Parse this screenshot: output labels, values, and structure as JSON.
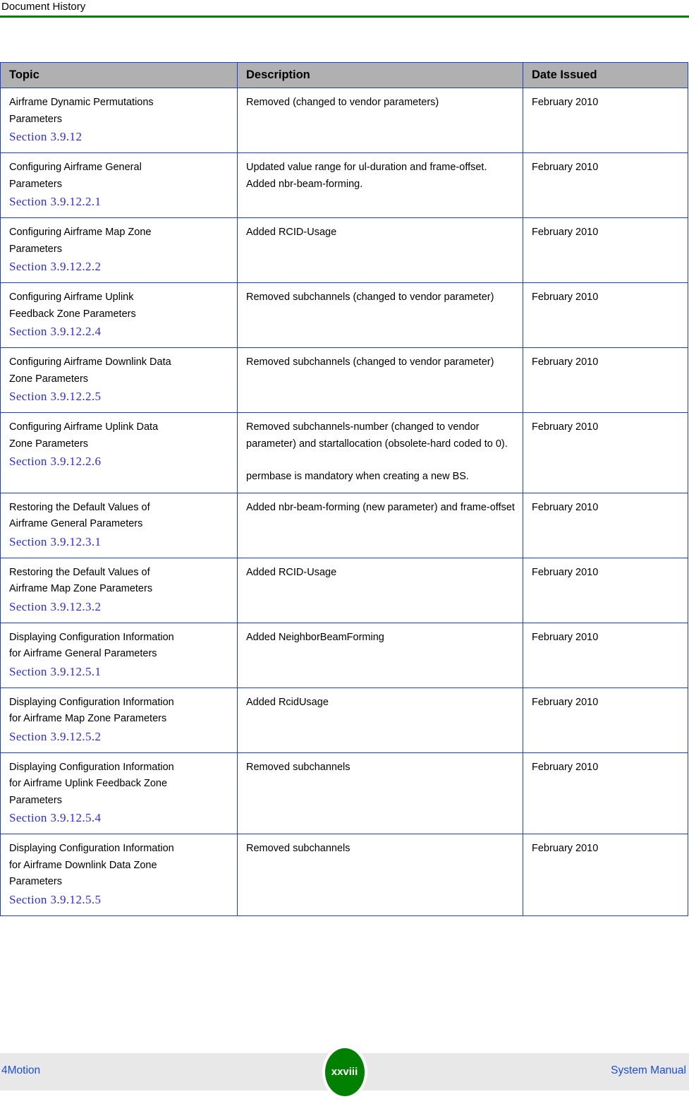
{
  "header": {
    "title": "Document History",
    "rule_color": "#008000"
  },
  "table": {
    "border_color": "#1a3ed0",
    "header_bg": "#b0b0b0",
    "link_color": "#2a2aee",
    "columns": [
      "Topic",
      "Description",
      "Date Issued"
    ],
    "rows": [
      {
        "topic_lines": [
          "Airframe Dynamic Permutations",
          "Parameters"
        ],
        "section": "Section 3.9.12",
        "description": [
          "Removed (changed to vendor parameters)"
        ],
        "date": "February 2010"
      },
      {
        "topic_lines": [
          "Configuring Airframe General",
          "Parameters"
        ],
        "section": "Section 3.9.12.2.1",
        "description": [
          "Updated value range for ul-duration and frame-offset. Added nbr-beam-forming."
        ],
        "date": "February 2010"
      },
      {
        "topic_lines": [
          "Configuring Airframe Map Zone",
          "Parameters"
        ],
        "section": "Section 3.9.12.2.2",
        "description": [
          "Added RCID-Usage"
        ],
        "date": "February 2010"
      },
      {
        "topic_lines": [
          "Configuring Airframe Uplink",
          "Feedback Zone Parameters"
        ],
        "section": "Section 3.9.12.2.4",
        "description": [
          "Removed subchannels (changed to vendor parameter)"
        ],
        "date": "February 2010"
      },
      {
        "topic_lines": [
          "Configuring Airframe Downlink Data",
          "Zone Parameters"
        ],
        "section": "Section 3.9.12.2.5",
        "description": [
          "Removed subchannels (changed to vendor parameter)"
        ],
        "date": "February 2010"
      },
      {
        "topic_lines": [
          "Configuring Airframe Uplink Data",
          "Zone Parameters"
        ],
        "section": "Section 3.9.12.2.6",
        "description": [
          "Removed subchannels-number (changed to vendor parameter) and startallocation (obsolete-hard coded to 0).",
          "permbase is mandatory when creating a new BS."
        ],
        "date": "February 2010"
      },
      {
        "topic_lines": [
          "Restoring the Default Values of",
          "Airframe General Parameters"
        ],
        "section": "Section 3.9.12.3.1",
        "description": [
          "Added nbr-beam-forming (new parameter) and frame-offset"
        ],
        "date": "February 2010"
      },
      {
        "topic_lines": [
          "Restoring the Default Values of",
          "Airframe Map Zone Parameters"
        ],
        "section": "Section 3.9.12.3.2",
        "description": [
          "Added RCID-Usage"
        ],
        "date": "February 2010"
      },
      {
        "topic_lines": [
          "Displaying Configuration Information",
          "for Airframe General Parameters"
        ],
        "section": "Section 3.9.12.5.1",
        "description": [
          "Added NeighborBeamForming"
        ],
        "date": "February 2010"
      },
      {
        "topic_lines": [
          "Displaying Configuration Information",
          "for Airframe Map Zone Parameters"
        ],
        "section": "Section 3.9.12.5.2",
        "description": [
          "Added RcidUsage"
        ],
        "date": "February 2010"
      },
      {
        "topic_lines": [
          "Displaying Configuration Information",
          "for Airframe Uplink Feedback Zone",
          "Parameters"
        ],
        "section": "Section 3.9.12.5.4",
        "description": [
          "Removed subchannels"
        ],
        "date": "February 2010"
      },
      {
        "topic_lines": [
          "Displaying Configuration Information",
          "for Airframe Downlink Data Zone",
          "Parameters"
        ],
        "section": "Section 3.9.12.5.5",
        "description": [
          "Removed subchannels"
        ],
        "date": "February 2010"
      }
    ]
  },
  "footer": {
    "left": "4Motion",
    "right": "System Manual",
    "page_number": "xxviii",
    "badge_color": "#008000",
    "text_color": "#1a4de0",
    "band_color": "#e8e8e8"
  }
}
